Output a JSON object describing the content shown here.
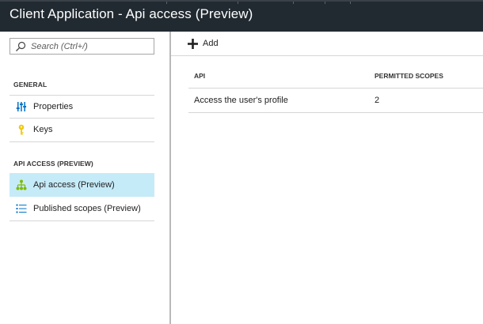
{
  "header": {
    "title": "Client Application - Api access (Preview)"
  },
  "sidebar": {
    "search": {
      "placeholder": "Search (Ctrl+/)",
      "value": ""
    },
    "sections": [
      {
        "heading": "GENERAL",
        "items": [
          {
            "label": "Properties",
            "icon": "properties-icon"
          },
          {
            "label": "Keys",
            "icon": "key-icon"
          }
        ]
      },
      {
        "heading": "API ACCESS (PREVIEW)",
        "items": [
          {
            "label": "Api access (Preview)",
            "icon": "api-access-icon",
            "selected": true
          },
          {
            "label": "Published scopes (Preview)",
            "icon": "list-icon"
          }
        ]
      }
    ]
  },
  "toolbar": {
    "add_label": "Add"
  },
  "table": {
    "columns": [
      "API",
      "PERMITTED SCOPES"
    ],
    "rows": [
      [
        "Access the user's profile",
        "2"
      ]
    ]
  },
  "colors": {
    "header_bg": "#222a31",
    "selected_bg": "#c6ebf8",
    "accent_blue": "#0072c6",
    "key_yellow": "#f2c811",
    "api_green": "#7fba00"
  }
}
